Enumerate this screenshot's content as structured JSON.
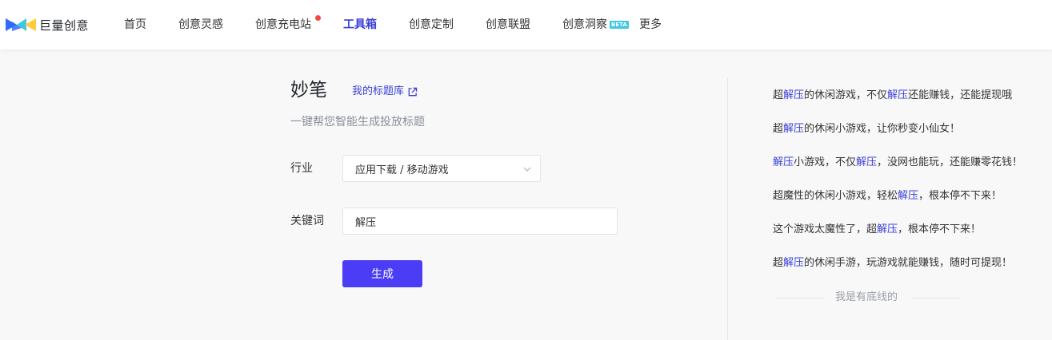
{
  "brand": {
    "name": "巨量创意",
    "colors": {
      "blue": "#2f6bff",
      "teal": "#3ec8e0",
      "yellow": "#ffc933"
    }
  },
  "nav": {
    "items": [
      {
        "label": "首页"
      },
      {
        "label": "创意灵感"
      },
      {
        "label": "创意充电站"
      },
      {
        "label": "工具箱"
      },
      {
        "label": "创意定制"
      },
      {
        "label": "创意联盟"
      },
      {
        "label": "创意洞察"
      },
      {
        "label": "更多"
      }
    ],
    "beta_badge": "BETA",
    "active": "工具箱"
  },
  "tool": {
    "title": "妙笔",
    "title_library_link": "我的标题库",
    "subtitle": "一键帮您智能生成投放标题",
    "industry_label": "行业",
    "industry_value": "应用下载 / 移动游戏",
    "keyword_label": "关键词",
    "keyword_value": "解压",
    "generate_label": "生成"
  },
  "results": {
    "items": [
      {
        "parts": [
          {
            "t": "超"
          },
          {
            "t": "解压",
            "h": true
          },
          {
            "t": "的休闲游戏，不仅"
          },
          {
            "t": "解压",
            "h": true
          },
          {
            "t": "还能赚钱，还能提现哦"
          }
        ]
      },
      {
        "parts": [
          {
            "t": "超"
          },
          {
            "t": "解压",
            "h": true
          },
          {
            "t": "的休闲小游戏，让你秒变小仙女！"
          }
        ]
      },
      {
        "parts": [
          {
            "t": "解压",
            "h": true
          },
          {
            "t": "小游戏，不仅"
          },
          {
            "t": "解压",
            "h": true
          },
          {
            "t": "，没网也能玩，还能赚零花钱！"
          }
        ]
      },
      {
        "parts": [
          {
            "t": "超魔性的休闲小游戏，轻松"
          },
          {
            "t": "解压",
            "h": true
          },
          {
            "t": "，根本停不下来！"
          }
        ]
      },
      {
        "parts": [
          {
            "t": "这个游戏太魔性了，超"
          },
          {
            "t": "解压",
            "h": true
          },
          {
            "t": "，根本停不下来！"
          }
        ]
      },
      {
        "parts": [
          {
            "t": "超"
          },
          {
            "t": "解压",
            "h": true
          },
          {
            "t": "的休闲手游，玩游戏就能赚钱，随时可提现！"
          }
        ]
      }
    ],
    "end_text": "我是有底线的"
  },
  "colors": {
    "accent": "#3a3fd6",
    "button": "#4b3cf5",
    "notification_dot": "#f5473b"
  }
}
